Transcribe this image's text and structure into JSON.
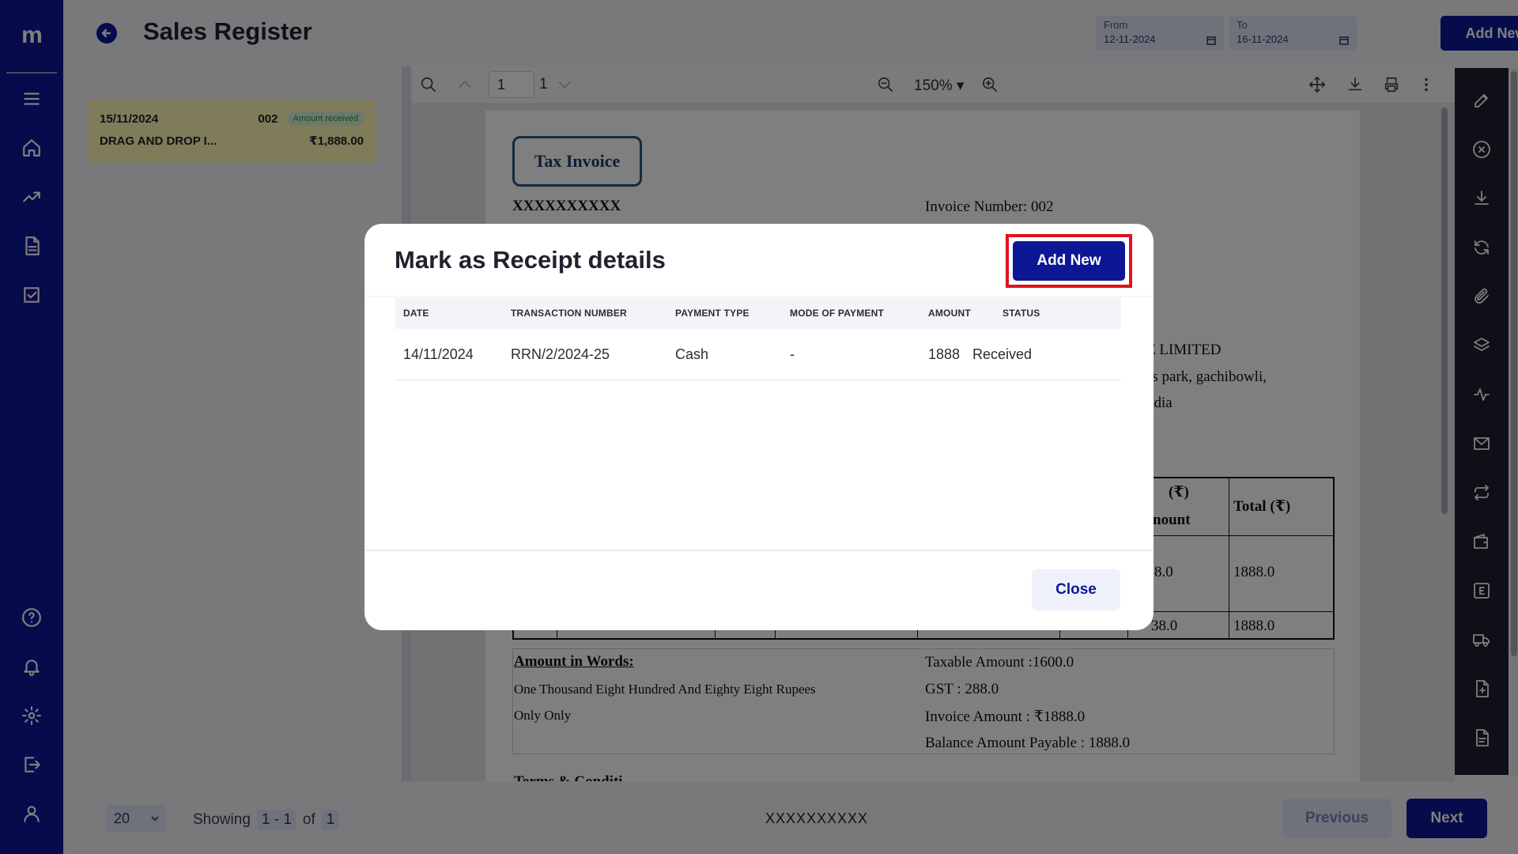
{
  "app": {
    "logo": "m"
  },
  "header": {
    "title": "Sales Register",
    "from_label": "From",
    "from_value": "12-11-2024",
    "to_label": "To",
    "to_value": "16-11-2024",
    "add_new_label": "Add New"
  },
  "list": {
    "items": [
      {
        "date": "15/11/2024",
        "number": "002",
        "status": "Amount received",
        "name": "DRAG AND DROP I...",
        "amount": "₹1,888.00"
      }
    ]
  },
  "viewer": {
    "page_input": "1",
    "page_total": "1",
    "zoom": "150%"
  },
  "document": {
    "title": "Tax Invoice",
    "company": "XXXXXXXXXX",
    "invoice_number": "Invoice Number: 002",
    "billto_line1": "E LIMITED",
    "billto_line2": "ss park, gachibowli,",
    "billto_line3": "ndia",
    "col_tax_head": "(₹)",
    "col_tax_sub": "nount",
    "col_total_head": "Total (₹)",
    "row1_tax": "8.0",
    "row1_total": "1888.0",
    "row2_tax": "38.0",
    "row2_total": "1888.0",
    "amount_in_words_label": "Amount in Words:",
    "amount_in_words_line1": "One Thousand Eight Hundred And Eighty Eight Rupees",
    "amount_in_words_line2": "Only Only",
    "taxable_amount": "Taxable Amount :1600.0",
    "gst": "GST : 288.0",
    "invoice_amount": "Invoice Amount : ₹1888.0",
    "balance_payable": "Balance Amount Payable : 1888.0",
    "terms_partial": "Terms & Conditi"
  },
  "footer": {
    "page_size": "20",
    "showing_label": "Showing",
    "range": "1 - 1",
    "of_label": "of",
    "total": "1",
    "company": "XXXXXXXXXX",
    "previous_label": "Previous",
    "next_label": "Next"
  },
  "modal": {
    "title": "Mark as Receipt details",
    "add_new_label": "Add New",
    "columns": [
      "DATE",
      "TRANSACTION NUMBER",
      "PAYMENT TYPE",
      "MODE OF PAYMENT",
      "AMOUNT",
      "STATUS"
    ],
    "rows": [
      {
        "date": "14/11/2024",
        "transaction_number": "RRN/2/2024-25",
        "payment_type": "Cash",
        "mode_of_payment": "-",
        "amount": "1888",
        "status": "Received"
      }
    ],
    "close_label": "Close"
  },
  "colors": {
    "primary": "#0c1796",
    "highlight": "#e0121f",
    "card_bg": "#fff9b5",
    "badge_text": "#2e8b3c"
  }
}
